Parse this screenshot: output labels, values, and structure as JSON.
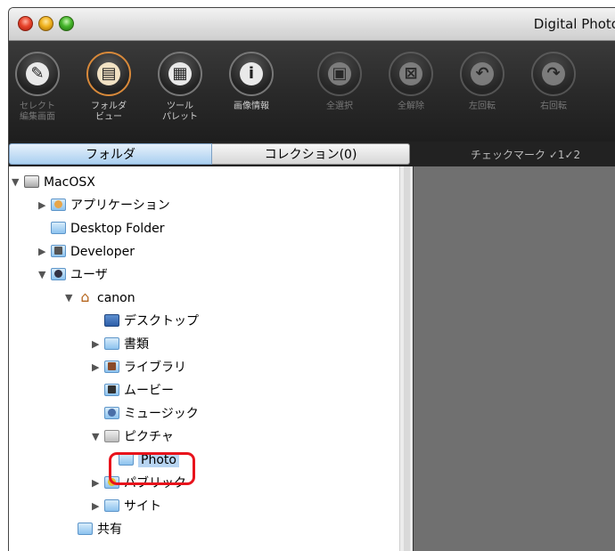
{
  "window": {
    "title": "Digital Photo"
  },
  "toolbar": {
    "buttons": [
      {
        "label": "セレクト\n編集画面",
        "icon": "select-edit-icon"
      },
      {
        "label": "フォルダ\nビュー",
        "icon": "folder-view-icon"
      },
      {
        "label": "ツール\nパレット",
        "icon": "tool-palette-icon"
      },
      {
        "label": "画像情報",
        "icon": "info-icon"
      },
      {
        "label": "全選択",
        "icon": "select-all-icon"
      },
      {
        "label": "全解除",
        "icon": "deselect-all-icon"
      },
      {
        "label": "左回転",
        "icon": "rotate-left-icon"
      },
      {
        "label": "右回転",
        "icon": "rotate-right-icon"
      }
    ]
  },
  "tabs": {
    "folder": "フォルダ",
    "collection": "コレクション(0)"
  },
  "checkmark_label": "チェックマーク ✓1✓2",
  "tree": {
    "items": [
      {
        "label": "MacOSX"
      },
      {
        "label": "アプリケーション"
      },
      {
        "label": "Desktop Folder"
      },
      {
        "label": "Developer"
      },
      {
        "label": "ユーザ"
      },
      {
        "label": "canon"
      },
      {
        "label": "デスクトップ"
      },
      {
        "label": "書類"
      },
      {
        "label": "ライブラリ"
      },
      {
        "label": "ムービー"
      },
      {
        "label": "ミュージック"
      },
      {
        "label": "ピクチャ"
      },
      {
        "label": "Photo"
      },
      {
        "label": "パブリック"
      },
      {
        "label": "サイト"
      },
      {
        "label": "共有"
      }
    ]
  },
  "colors": {
    "highlight": "#e8131c",
    "selection": "#b7d4f2",
    "toolbar_bg": "#2a2a2a"
  }
}
